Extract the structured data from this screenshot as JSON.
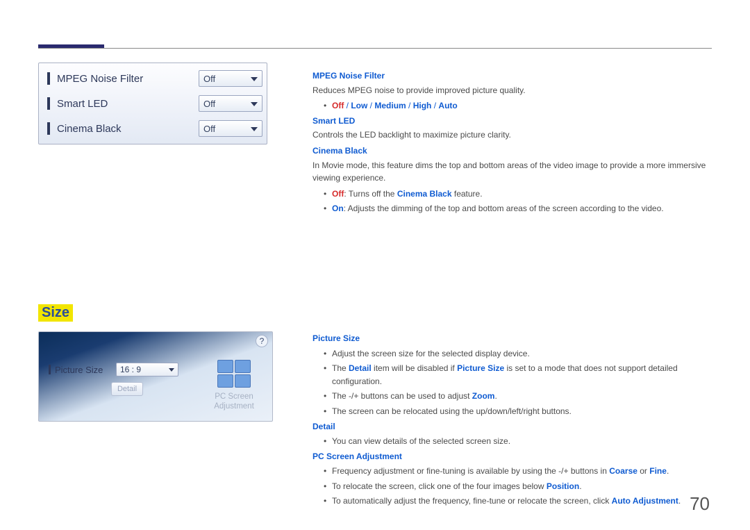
{
  "panel1": {
    "rows": [
      {
        "label": "MPEG Noise Filter",
        "value": "Off"
      },
      {
        "label": "Smart LED",
        "value": "Off"
      },
      {
        "label": "Cinema Black",
        "value": "Off"
      }
    ]
  },
  "sizeHeading": "Size",
  "panel2": {
    "help": "?",
    "label": "Picture Size",
    "value": "16 : 9",
    "detailBtn": "Detail",
    "pcLabel1": "PC Screen",
    "pcLabel2": "Adjustment"
  },
  "text": {
    "mpegTitle": "MPEG Noise Filter",
    "mpegDesc": "Reduces MPEG noise to provide improved picture quality.",
    "mpegOpts": {
      "off": "Off",
      "low": "Low",
      "medium": "Medium",
      "high": "High",
      "auto": "Auto",
      "sep": " / "
    },
    "smartTitle": "Smart LED",
    "smartDesc": "Controls the LED backlight to maximize picture clarity.",
    "cinemaTitle": "Cinema Black",
    "cinemaDesc": "In Movie mode, this feature dims the top and bottom areas of the video image to provide a more immersive viewing experience.",
    "cinemaOffLabel": "Off",
    "cinemaOffText": ": Turns off the ",
    "cinemaOffBold": "Cinema Black",
    "cinemaOffTail": " feature.",
    "cinemaOnLabel": "On",
    "cinemaOnText": ": Adjusts the dimming of the top and bottom areas of the screen according to the video.",
    "picSizeTitle": "Picture Size",
    "picSize1": "Adjust the screen size for the selected display device.",
    "picSize2a": "The ",
    "picSize2Detail": "Detail",
    "picSize2b": " item will be disabled if ",
    "picSize2PS": "Picture Size",
    "picSize2c": " is set to a mode that does not support detailed configuration.",
    "picSize3a": "The -/+ buttons can be used to adjust ",
    "picSize3Zoom": "Zoom",
    "picSize3b": ".",
    "picSize4": "The screen can be relocated using the up/down/left/right buttons.",
    "detailTitle": "Detail",
    "detail1": "You can view details of the selected screen size.",
    "pcAdjTitle": "PC Screen Adjustment",
    "pcAdj1a": "Frequency adjustment or fine-tuning is available by using the -/+ buttons in ",
    "pcAdj1Coarse": "Coarse",
    "pcAdj1or": " or ",
    "pcAdj1Fine": "Fine",
    "pcAdj1b": ".",
    "pcAdj2a": "To relocate the screen, click one of the four images below ",
    "pcAdj2Pos": "Position",
    "pcAdj2b": ".",
    "pcAdj3a": "To automatically adjust the frequency, fine-tune or relocate the screen, click ",
    "pcAdj3Auto": "Auto Adjustment",
    "pcAdj3b": "."
  },
  "pageNumber": "70"
}
